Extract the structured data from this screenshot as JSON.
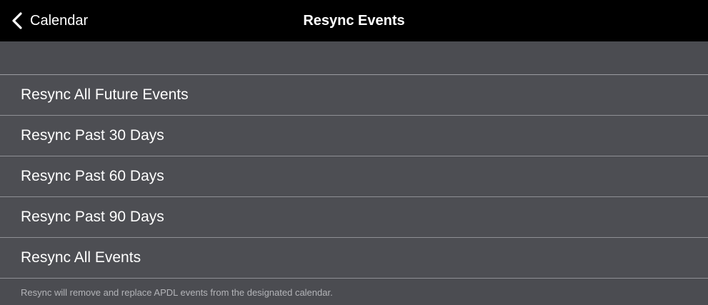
{
  "navbar": {
    "back_label": "Calendar",
    "title": "Resync Events",
    "back_icon": "chevron-left-icon"
  },
  "list": {
    "items": [
      {
        "label": "Resync All Future Events"
      },
      {
        "label": "Resync Past 30 Days"
      },
      {
        "label": "Resync Past 60 Days"
      },
      {
        "label": "Resync Past 90 Days"
      },
      {
        "label": "Resync All Events"
      }
    ]
  },
  "footer": {
    "note": "Resync will remove and replace APDL events from the designated calendar."
  },
  "colors": {
    "navbar_bg": "#000000",
    "page_bg": "#4b4c51",
    "separator": "#8e8f94",
    "footer_text": "#b3b4b8"
  }
}
